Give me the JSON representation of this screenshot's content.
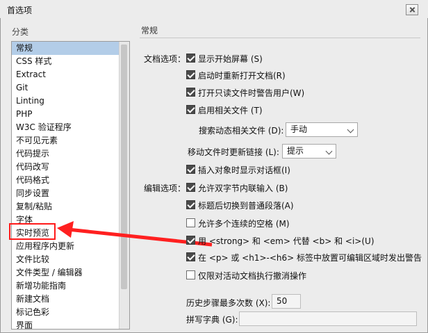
{
  "window": {
    "title": "首选项"
  },
  "sidebar": {
    "label": "分类",
    "items": [
      {
        "label": "常规",
        "selected": true
      },
      {
        "label": "CSS 样式"
      },
      {
        "label": "Extract"
      },
      {
        "label": "Git"
      },
      {
        "label": "Linting"
      },
      {
        "label": "PHP"
      },
      {
        "label": "W3C 验证程序"
      },
      {
        "label": "不可见元素"
      },
      {
        "label": "代码提示"
      },
      {
        "label": "代码改写"
      },
      {
        "label": "代码格式"
      },
      {
        "label": "同步设置"
      },
      {
        "label": "复制/粘贴"
      },
      {
        "label": "字体"
      },
      {
        "label": "实时预览"
      },
      {
        "label": "应用程序内更新"
      },
      {
        "label": "文件比较"
      },
      {
        "label": "文件类型 / 编辑器"
      },
      {
        "label": "新增功能指南"
      },
      {
        "label": "新建文档"
      },
      {
        "label": "标记色彩"
      },
      {
        "label": "界面"
      }
    ]
  },
  "main": {
    "title": "常规",
    "doc_options_label": "文档选项：",
    "edit_options_label": "编辑选项：",
    "doc_options": [
      {
        "label": "显示开始屏幕 (S)",
        "checked": true
      },
      {
        "label": "启动时重新打开文档(R)",
        "checked": true
      },
      {
        "label": "打开只读文件时警告用户(W)",
        "checked": true
      },
      {
        "label": "启用相关文件 (T)",
        "checked": true
      }
    ],
    "search_related_label": "搜索动态相关文件 (D):",
    "search_related_value": "手动",
    "update_links_label": "移动文件时更新链接 (L):",
    "update_links_value": "提示",
    "insert_object": {
      "label": "插入对象时显示对话框(I)",
      "checked": true
    },
    "edit_options": [
      {
        "label": "允许双字节内联输入 (B)",
        "checked": true
      },
      {
        "label": "标题后切换到普通段落(A)",
        "checked": true
      },
      {
        "label": "允许多个连续的空格 (M)",
        "checked": false
      },
      {
        "label": "用 <strong> 和 <em> 代替 <b> 和 <i>(U)",
        "checked": true
      },
      {
        "label": "在 <p> 或 <h1>-<h6> 标签中放置可编辑区域时发出警告",
        "checked": true
      },
      {
        "label": "仅限对活动文档执行撤消操作",
        "checked": false
      }
    ],
    "history_label": "历史步骤最多次数 (X):",
    "history_value": "50",
    "spell_label": "拼写字典 (G):",
    "spell_value": ""
  },
  "annotation": {
    "color": "#ff2020"
  }
}
